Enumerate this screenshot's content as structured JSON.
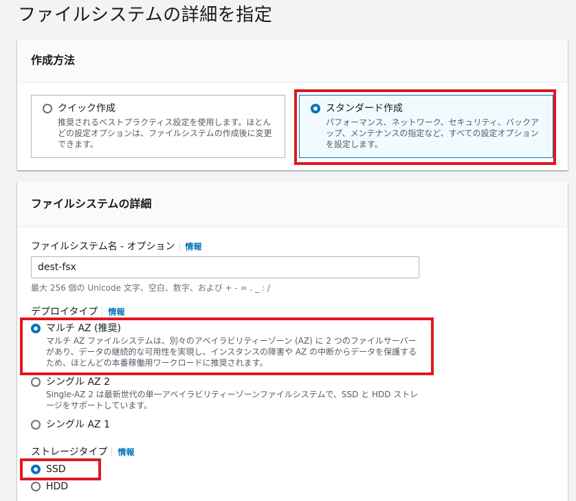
{
  "page": {
    "title": "ファイルシステムの詳細を指定"
  },
  "creation_method": {
    "heading": "作成方法",
    "options": [
      {
        "label": "クイック作成",
        "description": "推奨されるベストプラクティス設定を使用します。ほとんどの設定オプションは、ファイルシステムの作成後に変更できます。",
        "selected": false
      },
      {
        "label": "スタンダード作成",
        "description": "パフォーマンス、ネットワーク、セキュリティ、バックアップ、メンテナンスの指定など、すべての設定オプションを設定します。",
        "selected": true
      }
    ]
  },
  "fs_details": {
    "heading": "ファイルシステムの詳細",
    "name_label": "ファイルシステム名 - オプション",
    "info_link": "情報",
    "name_value": "dest-fsx",
    "name_hint": "最大 256 個の Unicode 文字、空白、数字、および + - = . _ : /",
    "deployment_label": "デプロイタイプ",
    "deployment_info": "情報",
    "deployment_options": [
      {
        "label": "マルチ AZ (推奨)",
        "description": "マルチ AZ ファイルシステムは、別々のアベイラビリティーゾーン (AZ) に 2 つのファイルサーバーがあり、データの継続的な可用性を実現し、インスタンスの障害や AZ の中断からデータを保護するため、ほとんどの本番稼働用ワークロードに推奨されます。",
        "selected": true
      },
      {
        "label": "シングル AZ 2",
        "description": "Single-AZ 2 は最新世代の単一アベイラビリティーゾーンファイルシステムで、SSD と HDD ストレージをサポートしています。",
        "selected": false
      },
      {
        "label": "シングル AZ 1",
        "description": "",
        "selected": false
      }
    ],
    "storage_label": "ストレージタイプ",
    "storage_info": "情報",
    "storage_options": [
      {
        "label": "SSD",
        "selected": true
      },
      {
        "label": "HDD",
        "selected": false
      }
    ]
  },
  "colors": {
    "accent": "#0073bb",
    "highlight": "#e0161f"
  }
}
